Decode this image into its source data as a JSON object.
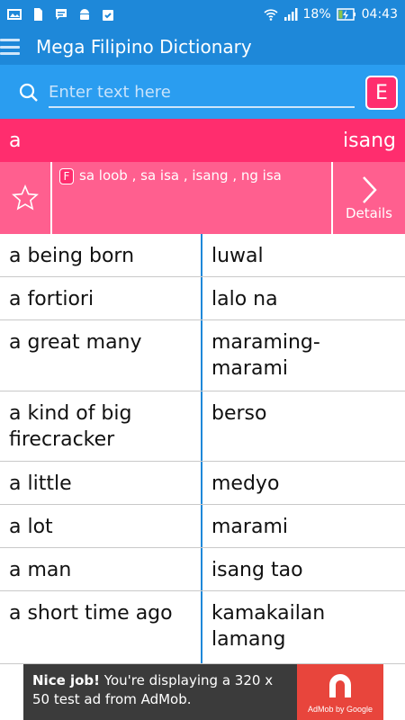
{
  "status_bar": {
    "battery": "18%",
    "time": "04:43"
  },
  "app_bar": {
    "title": "Mega Filipino Dictionary"
  },
  "search": {
    "placeholder": "Enter text here",
    "lang_toggle": "E"
  },
  "result": {
    "word": "a",
    "translation": "isang",
    "badge": "F",
    "meanings": "sa loob , sa isa , isang , ng isa",
    "details_label": "Details"
  },
  "entries": [
    {
      "en": "a being born",
      "fil": "luwal"
    },
    {
      "en": "a fortiori",
      "fil": "lalo na"
    },
    {
      "en": "a great many",
      "fil": "maraming-marami"
    },
    {
      "en": "a kind of big firecracker",
      "fil": "berso"
    },
    {
      "en": "a little",
      "fil": "medyo"
    },
    {
      "en": "a lot",
      "fil": "marami"
    },
    {
      "en": "a man",
      "fil": "isang tao"
    },
    {
      "en": "a short time ago",
      "fil": "kamakailan lamang"
    }
  ],
  "ad": {
    "headline": "Nice job!",
    "body": "You're displaying a 320 x 50 test ad from AdMob.",
    "by": "AdMob by Google"
  },
  "colors": {
    "primary": "#1e88d9",
    "search_bg": "#2a9df0",
    "accent": "#ff2d6e",
    "accent_light": "#ff5f8f"
  }
}
